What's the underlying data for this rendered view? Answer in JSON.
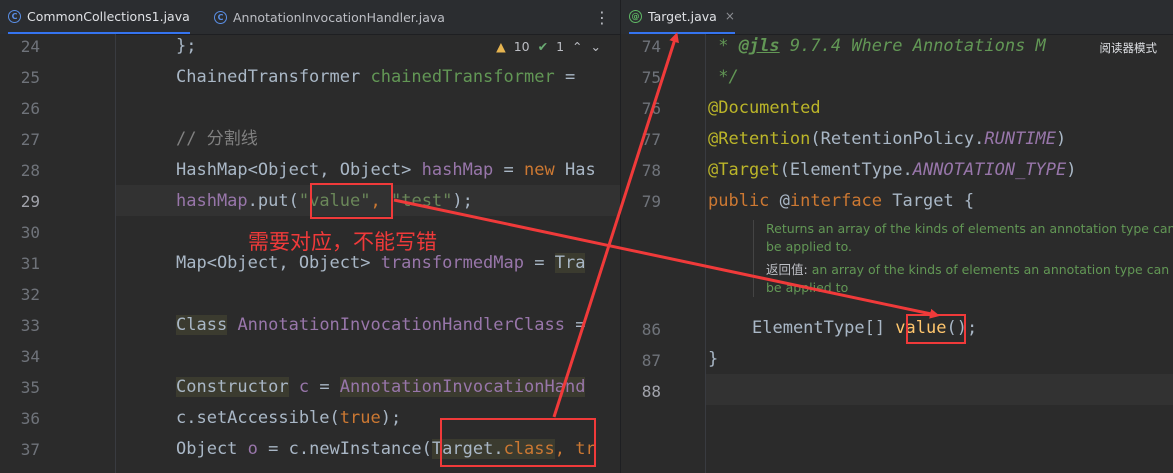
{
  "left_tabs": [
    {
      "label": "CommonCollections1.java",
      "icon": "class-icon"
    },
    {
      "label": "AnnotationInvocationHandler.java",
      "icon": "class-icon"
    }
  ],
  "left_tab_menu": "⋮",
  "right_tab": {
    "label": "Target.java",
    "icon": "annotation-icon",
    "close": "×"
  },
  "inspections": {
    "warnings": "10",
    "checks": "1"
  },
  "reader_mode": "阅读器模式",
  "left_line_numbers": [
    "24",
    "25",
    "26",
    "27",
    "28",
    "29",
    "30",
    "31",
    "32",
    "33",
    "34",
    "35",
    "36",
    "37"
  ],
  "left_code": {
    "l24": "};",
    "l25_a": "ChainedTransformer ",
    "l25_b": "chainedTransformer",
    "l25_c": " =",
    "l27": "// 分割线",
    "l28_a": "HashMap<Object, Object> ",
    "l28_b": "hashMap",
    "l28_c": " = ",
    "l28_d": "new",
    "l28_e": " Has",
    "l29_a": "hashMap",
    "l29_b": ".put(",
    "l29_c": "\"value\"",
    "l29_d": ", ",
    "l29_e": "\"test\"",
    "l29_f": ");",
    "l31_a": "Map<Object, Object> ",
    "l31_b": "transformedMap",
    "l31_c": " = ",
    "l31_d": "Tra",
    "l33_a": "Class",
    "l33_b": " ",
    "l33_c": "AnnotationInvocationHandlerClass",
    "l33_d": " =",
    "l35_a": "Constructor",
    "l35_b": " c",
    "l35_c": " = ",
    "l35_d": "AnnotationInvocationHand",
    "l36_a": "c.setAccessible(",
    "l36_b": "true",
    "l36_c": ");",
    "l37_a": "Object ",
    "l37_b": "o",
    "l37_c": " = c.newInstance(",
    "l37_d": "Target.",
    "l37_e": "class",
    "l37_f": ", ",
    "l37_g": "tr"
  },
  "annotation_text": "需要对应，不能写错",
  "right_line_numbers": [
    "74",
    "75",
    "76",
    "77",
    "78",
    "79",
    "86",
    "87",
    "88"
  ],
  "right_code": {
    "r74_a": " * ",
    "r74_b": "@jls",
    "r74_c": " 9.7.4 Where Annotations M",
    "r75": " */",
    "r76": "@Documented",
    "r77_a": "@Retention",
    "r77_b": "(RetentionPolicy.",
    "r77_c": "RUNTIME",
    "r77_d": ")",
    "r78_a": "@Target",
    "r78_b": "(ElementType.",
    "r78_c": "ANNOTATION_TYPE",
    "r78_d": ")",
    "r79_a": "public",
    "r79_b": " @",
    "r79_c": "interface",
    "r79_d": " Target {",
    "r86_a": "ElementType[] ",
    "r86_b": "value",
    "r86_c": "();",
    "r87": "}"
  },
  "doc_popup": {
    "en_1": "Returns an array of the kinds of elements an annotation type can",
    "en_2": "be applied to.",
    "zh_label": "返回值:",
    "zh_1": " an array of the kinds of elements an annotation type can",
    "zh_2": "be applied to"
  },
  "colors": {
    "background": "#2b2b2b",
    "keyword": "#cc7832",
    "string": "#6a8759",
    "field": "#9876aa",
    "annotation": "#bbb529",
    "method": "#ffc66d",
    "callout_red": "#f03a3a",
    "tab_accent": "#3574f0"
  }
}
